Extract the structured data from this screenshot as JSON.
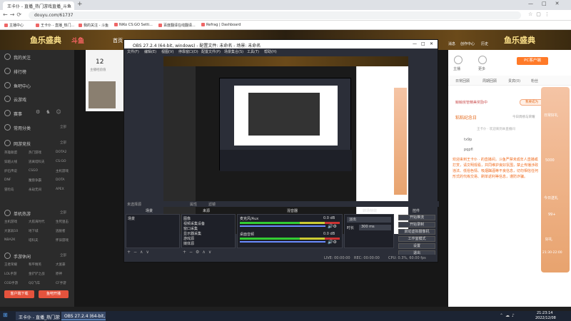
{
  "browser": {
    "tabs": [
      {
        "label": "王卡仆 - 直播_热门游戏直播_斗鱼",
        "active": true
      }
    ],
    "new_tab": "+",
    "url": "douyu.com/61737",
    "bookmarks": [
      "主播中心",
      "王卡仆 - 直播_热门...",
      "我的关注 - 斗鱼",
      "NiKo CS:GO Setti...",
      "百度翻译在线翻译...",
      "Refrag | Dashboard"
    ]
  },
  "site": {
    "banner_left": "鱼乐盛典",
    "logo": "斗鱼",
    "home": "首页",
    "banner_right": "鱼乐盛典",
    "header_icons": [
      "消息",
      "创作中心",
      "历史"
    ]
  },
  "left_nav": {
    "items": [
      "我的关注",
      "排行榜",
      "鱼吧中心",
      "云游戏"
    ],
    "tabs_row": [
      "赛事"
    ],
    "sections": [
      {
        "title": "常用分类",
        "more": "全部"
      },
      {
        "title": "网游竞技",
        "more": "全部",
        "grid": [
          "英雄联盟",
          "热门游戏",
          "DOTA2",
          "穿越火线",
          "逃离塔科夫",
          "CS:GO",
          "炉石传说",
          "CSGO",
          "主机游戏",
          "DNF",
          "魔兽争霸",
          "DOTA",
          "冒险岛",
          "永劫无间",
          "APEX"
        ]
      },
      {
        "title": "单机热游",
        "more": "全部",
        "grid": [
          "主机游戏",
          "大航海时代",
          "生死狙击",
          "大富翁10",
          "地下城",
          "逃脱者",
          "NBA2K",
          "塔科夫",
          "怀旧游戏"
        ]
      },
      {
        "title": "手游休闲",
        "more": "全部",
        "grid": [
          "王者荣耀",
          "和平精英",
          "大富豪",
          "LOL手游",
          "金铲铲之战",
          "原神",
          "COD手游",
          "QQ飞车",
          "CF手游"
        ]
      }
    ],
    "buttons": [
      "客户端下载",
      "鱼吧开播"
    ]
  },
  "room": {
    "follower_count": "12",
    "follower_label": "主播经验值"
  },
  "right_panel": {
    "icons": [
      "主播",
      "更多"
    ],
    "pc_button": "PC客户端",
    "tabs": [
      "日常回顾",
      "周期回顾",
      "贵宾(0)",
      "粉丝"
    ],
    "notice": "鲸鲸房管精美奖励中",
    "notice_btn": "我要成为",
    "welcome": "王卡仆 · 欢迎来到本直播间",
    "users": [
      "tx9p",
      "pqpfl"
    ],
    "rank_title": "粘粘纪念日",
    "rank_sub": "今日周榜与荣耀",
    "chat_text": "欢迎来到王卡仆 · 的直播间，斗鱼严禁未成年人直播或打赏，请文明观看，共同维护良好氛围，禁止传播涉政违法、低俗色情、吸烟酗酒等不良信息，切勿相信任何形式的代练交易、刷单返利等信息，谨防诈骗。",
    "float_ads": [
      "日常好礼",
      "5000",
      "今日送礼",
      "99+",
      "好礼",
      "21:30-22:00"
    ]
  },
  "obs": {
    "title": "OBS 27.2.4 (64-bit, windows) - 配置文件: 未命名 - 场景: 未命名",
    "window_buttons": [
      "—",
      "□",
      "✕"
    ],
    "menu": [
      "文件(F)",
      "编辑(E)",
      "视图(V)",
      "停靠窗口(D)",
      "配置文件(P)",
      "场景集合(S)",
      "工具(T)",
      "帮助(H)"
    ],
    "preview_label": "未选择源",
    "filter_buttons": [
      "属性",
      "滤镜"
    ],
    "docks": {
      "scenes": {
        "title": "场景",
        "items": [
          "场景"
        ]
      },
      "sources": {
        "title": "来源",
        "items": [
          "图像",
          "视频采集设备",
          "窗口采集",
          "显示器采集",
          "游戏源",
          "媒体源"
        ]
      },
      "mixer": {
        "title": "混音器",
        "channels": [
          {
            "name": "麦克风/Aux",
            "db": "0.0 dB"
          },
          {
            "name": "桌面音频",
            "db": "0.0 dB"
          }
        ]
      },
      "transitions": {
        "title": "转场特效",
        "type": "淡出",
        "duration_label": "时长",
        "duration": "300 ms"
      },
      "controls": {
        "title": "控件",
        "buttons": [
          "开始推流",
          "开始录制",
          "启动虚拟摄像机",
          "工作室模式",
          "设置",
          "退出"
        ]
      }
    },
    "status": {
      "live": "LIVE: 00:00:00",
      "rec": "REC: 00:00:00",
      "cpu": "CPU: 0.3%, 60.00 fps"
    }
  },
  "taskbar": {
    "start": "⊞",
    "tasks": [
      "王卡仆 - 直播_热门游戏...",
      "OBS 27.2.4 (64-bit, ..."
    ],
    "time": "21:23:14",
    "date": "2022/12/08"
  }
}
